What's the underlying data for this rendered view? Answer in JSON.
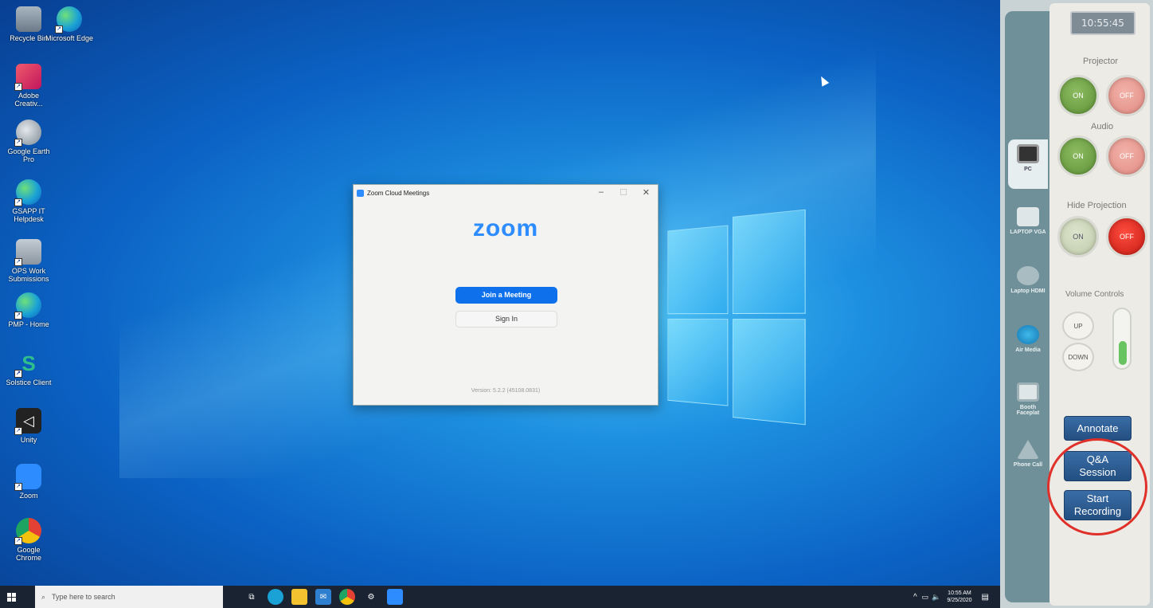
{
  "desktop": {
    "icons": [
      {
        "label": "Recycle Bin",
        "color": "#7d8b99"
      },
      {
        "label": "Microsoft Edge",
        "color": "#1aa1d6"
      },
      {
        "label": "Adobe Creativ...",
        "color": "#e04a5f"
      },
      {
        "label": "Google Earth Pro",
        "color": "#8c969e"
      },
      {
        "label": "GSAPP IT Helpdesk",
        "color": "#1aa1d6"
      },
      {
        "label": "OPS Work Submissions",
        "color": "#9aa6b0"
      },
      {
        "label": "PMP - Home",
        "color": "#1aa1d6"
      },
      {
        "label": "Solstice Client",
        "color": "#2fbf8a"
      },
      {
        "label": "Unity",
        "color": "#222222"
      },
      {
        "label": "Zoom",
        "color": "#2d8cff"
      },
      {
        "label": "Google Chrome",
        "color": "#e34133"
      }
    ]
  },
  "zoom_window": {
    "title": "Zoom Cloud Meetings",
    "brand": "zoom",
    "join_label": "Join a Meeting",
    "signin_label": "Sign In",
    "version": "Version: 5.2.2 (45108.0831)"
  },
  "taskbar": {
    "search_placeholder": "Type here to search",
    "time": "10:55 AM",
    "date": "9/25/2020"
  },
  "control_panel": {
    "time_display": "10:55:45",
    "projector_label": "Projector",
    "audio_label": "Audio",
    "hide_projection_label": "Hide Projection",
    "volume_label": "Volume Controls",
    "on": "ON",
    "off": "OFF",
    "up": "UP",
    "down": "DOWN",
    "volume_level": 0.4,
    "annotate": "Annotate",
    "qa": "Q&A Session",
    "record": "Start Recording",
    "sources": {
      "pc": "PC",
      "laptop_vga": "LAPTOP VGA",
      "laptop_hdmi": "Laptop HDMI",
      "air_media": "Air Media",
      "booth": "Booth Faceplat",
      "phone": "Phone Call"
    }
  }
}
